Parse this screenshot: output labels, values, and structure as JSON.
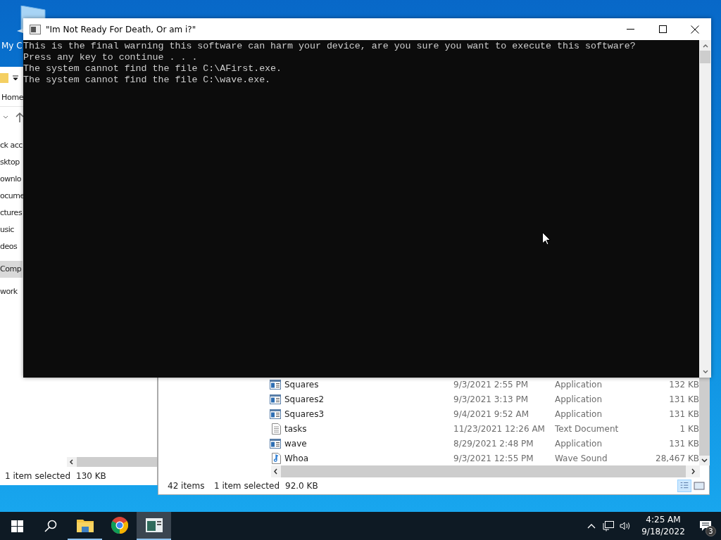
{
  "desktop_icons": [
    {
      "label": "My C"
    }
  ],
  "console_window": {
    "title": "\"Im Not Ready For Death, Or am i?\"",
    "lines": [
      "This is the final warning this software can harm your device, are you sure you want to execute this software?",
      "Press any key to continue . . .",
      "The system cannot find the file C:\\AFirst.exe.",
      "The system cannot find the file C:\\wave.exe."
    ]
  },
  "explorer_left": {
    "ribbon_tab": "Home",
    "nav_items": [
      {
        "label": "ck acc",
        "selected": false
      },
      {
        "label": "sktop",
        "selected": false
      },
      {
        "label": "ownlo",
        "selected": false
      },
      {
        "label": "ocume",
        "selected": false
      },
      {
        "label": "ctures",
        "selected": false
      },
      {
        "label": "usic",
        "selected": false
      },
      {
        "label": "deos",
        "selected": false
      },
      {
        "label": "Comp",
        "selected": true
      },
      {
        "label": "work",
        "selected": false
      }
    ],
    "status": [
      "1 item selected",
      "130 KB"
    ]
  },
  "explorer_right": {
    "files": [
      {
        "kind": "application",
        "name": "Squares",
        "date": "9/3/2021 2:55 PM",
        "type": "Application",
        "size": "132 KB"
      },
      {
        "kind": "application",
        "name": "Squares2",
        "date": "9/3/2021 3:13 PM",
        "type": "Application",
        "size": "131 KB"
      },
      {
        "kind": "application",
        "name": "Squares3",
        "date": "9/4/2021 9:52 AM",
        "type": "Application",
        "size": "131 KB"
      },
      {
        "kind": "text",
        "name": "tasks",
        "date": "11/23/2021 12:26 AM",
        "type": "Text Document",
        "size": "1 KB"
      },
      {
        "kind": "application",
        "name": "wave",
        "date": "8/29/2021 2:48 PM",
        "type": "Application",
        "size": "131 KB"
      },
      {
        "kind": "sound",
        "name": "Whoa",
        "date": "9/3/2021 12:55 PM",
        "type": "Wave Sound",
        "size": "28,467 KB"
      }
    ],
    "status": [
      "42 items",
      "1 item selected",
      "92.0 KB"
    ]
  },
  "taskbar": {
    "apps": [
      {
        "kind": "explorer",
        "selected": false,
        "running": true
      },
      {
        "kind": "chrome",
        "selected": false,
        "running": false
      },
      {
        "kind": "console",
        "selected": true,
        "running": true
      }
    ],
    "time": "4:25 AM",
    "date": "9/18/2022",
    "notification_count": "3"
  }
}
